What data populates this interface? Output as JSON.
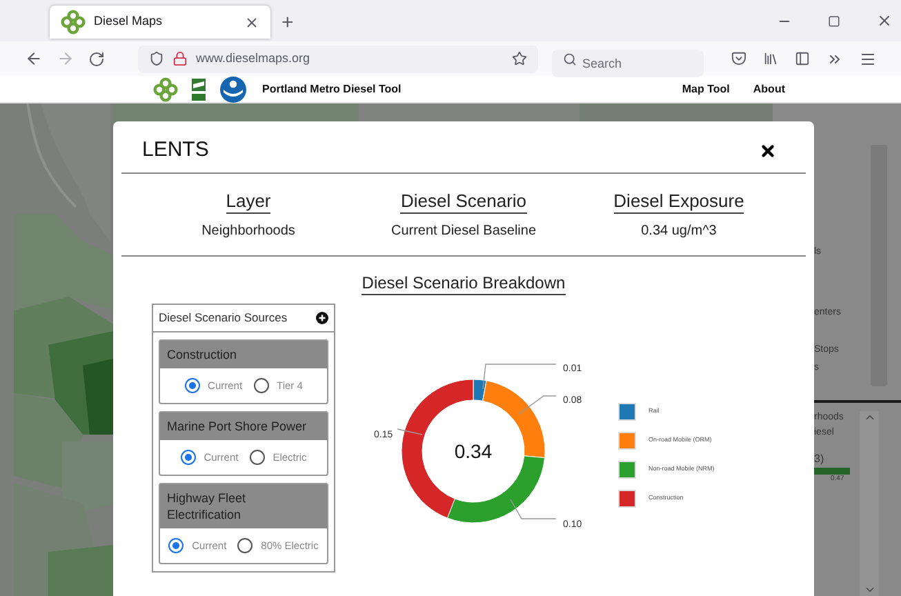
{
  "browser": {
    "tab": {
      "title": "Diesel Maps"
    },
    "new_tab": "+",
    "url": "www.dieselmaps.org",
    "search": {
      "placeholder": "Search"
    }
  },
  "site_nav": {
    "title": "Portland Metro Diesel Tool",
    "links": [
      "Map Tool",
      "About"
    ]
  },
  "side_panel": {
    "texts": [
      "ls",
      "enters",
      "Stops",
      "s",
      "rhoods",
      "iesel",
      "3)"
    ],
    "bar_reading": "0.47"
  },
  "modal": {
    "title": "LENTS",
    "summary": [
      {
        "heading": "Layer",
        "value": "Neighborhoods"
      },
      {
        "heading": "Diesel Scenario",
        "value": "Current Diesel Baseline"
      },
      {
        "heading": "Diesel Exposure",
        "value": "0.34 ug/m^3"
      }
    ],
    "breakdown": {
      "title": "Diesel Scenario Breakdown",
      "sources": {
        "title": "Diesel Scenario Sources",
        "groups": [
          {
            "name": "Construction",
            "options": [
              {
                "label": "Current",
                "selected": true
              },
              {
                "label": "Tier 4",
                "selected": false
              }
            ]
          },
          {
            "name": "Marine Port Shore Power",
            "options": [
              {
                "label": "Current",
                "selected": true
              },
              {
                "label": "Electric",
                "selected": false
              }
            ]
          },
          {
            "name": "Highway Fleet Electrification",
            "options": [
              {
                "label": "Current",
                "selected": true
              },
              {
                "label": "80% Electric",
                "selected": false
              }
            ]
          }
        ]
      },
      "center_label": "0.34",
      "chart_data": {
        "type": "donut",
        "categories": [
          "Rail",
          "On-road Mobile (ORM)",
          "Non-road Mobile (NRM)",
          "Construction"
        ],
        "values": [
          0.01,
          0.08,
          0.1,
          0.15
        ],
        "value_labels": [
          "0.01",
          "0.08",
          "0.10",
          "0.15"
        ],
        "colors": [
          "#1f77b4",
          "#ff7f0e",
          "#2ca02c",
          "#d62728"
        ]
      }
    }
  }
}
